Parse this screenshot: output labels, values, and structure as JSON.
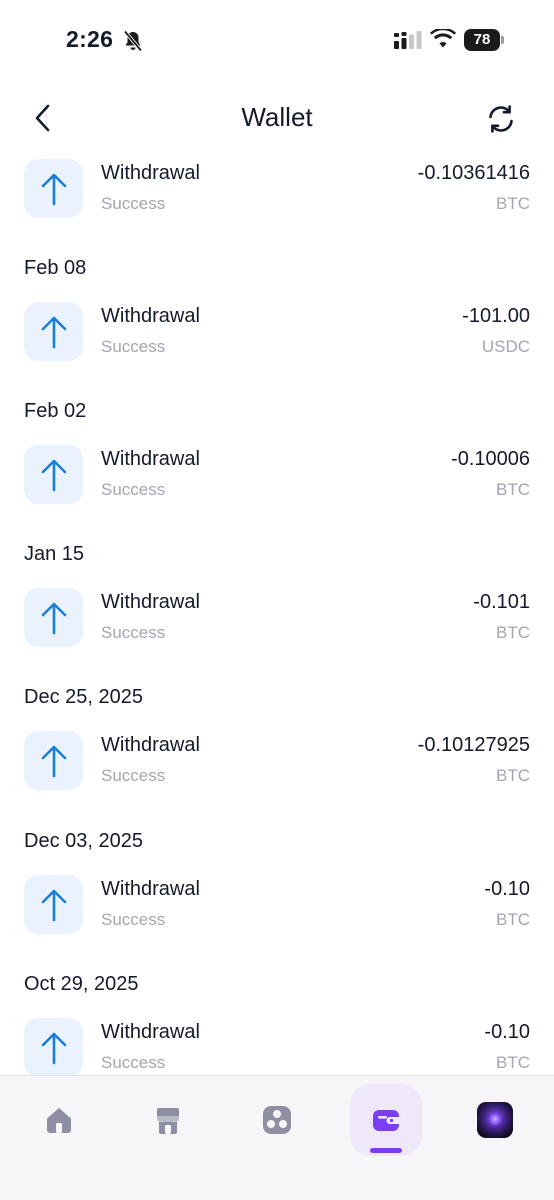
{
  "status_bar": {
    "time": "2:26",
    "battery": "78"
  },
  "header": {
    "title": "Wallet"
  },
  "colors": {
    "accent": "#7a3ff0",
    "icon_blue": "#1a7fd6",
    "icon_bg": "#eaf3fd",
    "muted_text": "#a3a6b3"
  },
  "transactions": [
    {
      "date": "",
      "type": "Withdrawal",
      "status": "Success",
      "amount": "-0.10361416",
      "currency": "BTC",
      "icon": "arrow-up-icon"
    },
    {
      "date": "Feb 08",
      "type": "Withdrawal",
      "status": "Success",
      "amount": "-101.00",
      "currency": "USDC",
      "icon": "arrow-up-icon"
    },
    {
      "date": "Feb 02",
      "type": "Withdrawal",
      "status": "Success",
      "amount": "-0.10006",
      "currency": "BTC",
      "icon": "arrow-up-icon"
    },
    {
      "date": "Jan 15",
      "type": "Withdrawal",
      "status": "Success",
      "amount": "-0.101",
      "currency": "BTC",
      "icon": "arrow-up-icon"
    },
    {
      "date": "Dec 25, 2025",
      "type": "Withdrawal",
      "status": "Success",
      "amount": "-0.10127925",
      "currency": "BTC",
      "icon": "arrow-up-icon"
    },
    {
      "date": "Dec 03, 2025",
      "type": "Withdrawal",
      "status": "Success",
      "amount": "-0.10",
      "currency": "BTC",
      "icon": "arrow-up-icon"
    },
    {
      "date": "Oct 29, 2025",
      "type": "Withdrawal",
      "status": "Success",
      "amount": "-0.10",
      "currency": "BTC",
      "icon": "arrow-up-icon"
    }
  ],
  "bottom_nav": {
    "items": [
      {
        "icon": "home-icon",
        "active": false
      },
      {
        "icon": "store-icon",
        "active": false
      },
      {
        "icon": "apps-icon",
        "active": false
      },
      {
        "icon": "wallet-icon",
        "active": true
      },
      {
        "icon": "avatar-icon",
        "active": false
      }
    ]
  }
}
